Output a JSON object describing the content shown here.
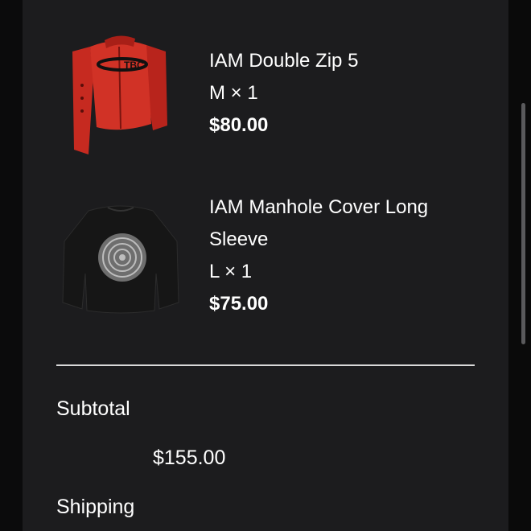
{
  "cart": {
    "items": [
      {
        "name": "IAM Double Zip 5",
        "variant": "M × 1",
        "price": "$80.00",
        "image_desc": "red-zip-jacket",
        "color": "#c8281f"
      },
      {
        "name_line1": "IAM Manhole Cover Long",
        "name_line2": "Sleeve",
        "variant": "L × 1",
        "price": "$75.00",
        "image_desc": "black-long-sleeve-shirt",
        "color": "#141414"
      }
    ]
  },
  "summary": {
    "subtotal_label": "Subtotal",
    "subtotal_value": "$155.00",
    "shipping_label": "Shipping"
  },
  "theme": {
    "panel_bg": "#1c1c1e",
    "text": "#ffffff",
    "divider": "#d9d9d9"
  }
}
